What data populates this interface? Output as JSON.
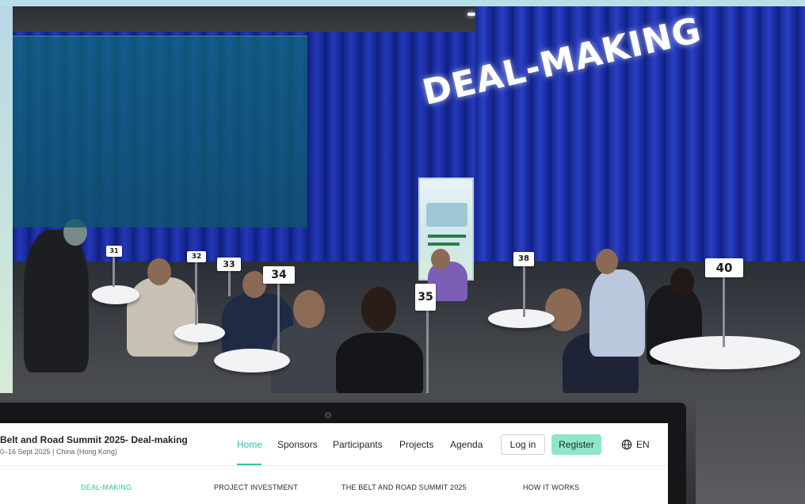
{
  "scene": {
    "sign_text": "DEAL-MAKING",
    "table_numbers": [
      "31",
      "32",
      "33",
      "34",
      "35",
      "38",
      "40"
    ]
  },
  "site": {
    "title": "Belt and Road Summit 2025- Deal-making",
    "subtitle": "0–16 Sept 2025 | China (Hong Kong)",
    "nav": {
      "home": "Home",
      "sponsors": "Sponsors",
      "participants": "Participants",
      "projects": "Projects",
      "agenda": "Agenda"
    },
    "login_label": "Log in",
    "register_label": "Register",
    "language": "EN",
    "subnav": {
      "deal_making": "DEAL-MAKING",
      "project_investment": "PROJECT INVESTMENT",
      "belt_road_summit": "THE BELT AND ROAD SUMMIT 2025",
      "how_it_works": "HOW IT WORKS"
    }
  },
  "colors": {
    "accent": "#32c3a0",
    "register_bg": "#8fe6c6",
    "curtain": "#1f33b0"
  }
}
